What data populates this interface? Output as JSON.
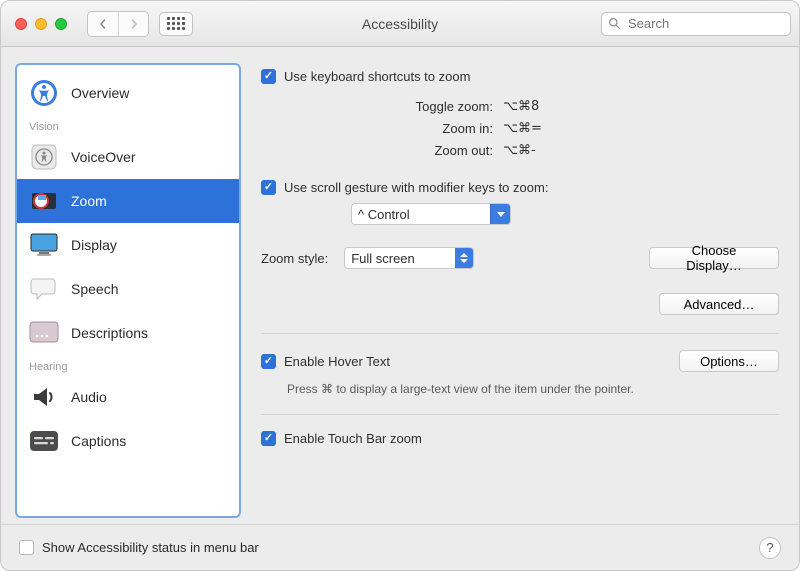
{
  "window": {
    "title": "Accessibility"
  },
  "search": {
    "placeholder": "Search"
  },
  "sidebar": {
    "items": [
      {
        "label": "Overview"
      }
    ],
    "groups": {
      "vision": "Vision",
      "hearing": "Hearing"
    },
    "vision_items": [
      {
        "label": "VoiceOver"
      },
      {
        "label": "Zoom",
        "selected": true
      },
      {
        "label": "Display"
      },
      {
        "label": "Speech"
      },
      {
        "label": "Descriptions"
      }
    ],
    "hearing_items": [
      {
        "label": "Audio"
      },
      {
        "label": "Captions"
      }
    ]
  },
  "content": {
    "kb_shortcuts_label": "Use keyboard shortcuts to zoom",
    "shortcuts": {
      "toggle_label": "Toggle zoom:",
      "toggle_keys": "⌥⌘8",
      "in_label": "Zoom in:",
      "in_keys": "⌥⌘=",
      "out_label": "Zoom out:",
      "out_keys": "⌥⌘-"
    },
    "scroll_gesture_label": "Use scroll gesture with modifier keys to zoom:",
    "modifier_value": "^ Control",
    "zoom_style_label": "Zoom style:",
    "zoom_style_value": "Full screen",
    "choose_display_label": "Choose Display…",
    "advanced_label": "Advanced…",
    "hover_text_label": "Enable Hover Text",
    "options_label": "Options…",
    "hover_hint": "Press ⌘ to display a large-text view of the item under the pointer.",
    "touchbar_label": "Enable Touch Bar zoom"
  },
  "footer": {
    "status_label": "Show Accessibility status in menu bar"
  }
}
